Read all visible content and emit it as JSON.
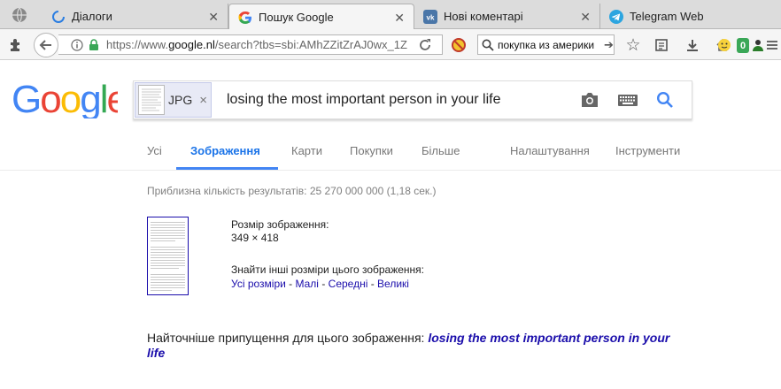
{
  "tabs": [
    {
      "label": "Діалоги",
      "icon": "loading-ring-icon"
    },
    {
      "label": "Пошук Google",
      "icon": "google-g-icon",
      "active": true
    },
    {
      "label": "Нові коментарі",
      "icon": "vk-icon"
    },
    {
      "label": "Telegram Web",
      "icon": "telegram-icon"
    }
  ],
  "navbar": {
    "url_prefix": "https://www.",
    "url_domain": "google.nl",
    "url_rest": "/search?tbs=sbi:AMhZZitZrAJ0wx_1Z",
    "search_value": "покупка из америки",
    "badge_count": "0"
  },
  "search": {
    "chip_label": "JPG",
    "chip_close": "×",
    "query": "losing the most important person in your life"
  },
  "gtabs": {
    "all": "Усі",
    "images": "Зображення",
    "maps": "Карти",
    "shopping": "Покупки",
    "more": "Більше",
    "settings": "Налаштування",
    "tools": "Інструменти"
  },
  "result_stats": "Приблизна кількість результатів: 25 270 000 000 (1,18 сек.)",
  "image_info": {
    "size_label": "Розмір зображення:",
    "size_value": "349 × 418",
    "find_other": "Знайти інші розміри цього зображення:",
    "links": [
      "Усі розміри",
      "Малі",
      "Середні",
      "Великі"
    ],
    "separator": " - "
  },
  "best_guess": {
    "label": "Найточніше припущення для цього зображення:",
    "value": "losing the most important person in your life"
  },
  "colors": {
    "link": "#1a0dab",
    "accent": "#4285f4"
  }
}
